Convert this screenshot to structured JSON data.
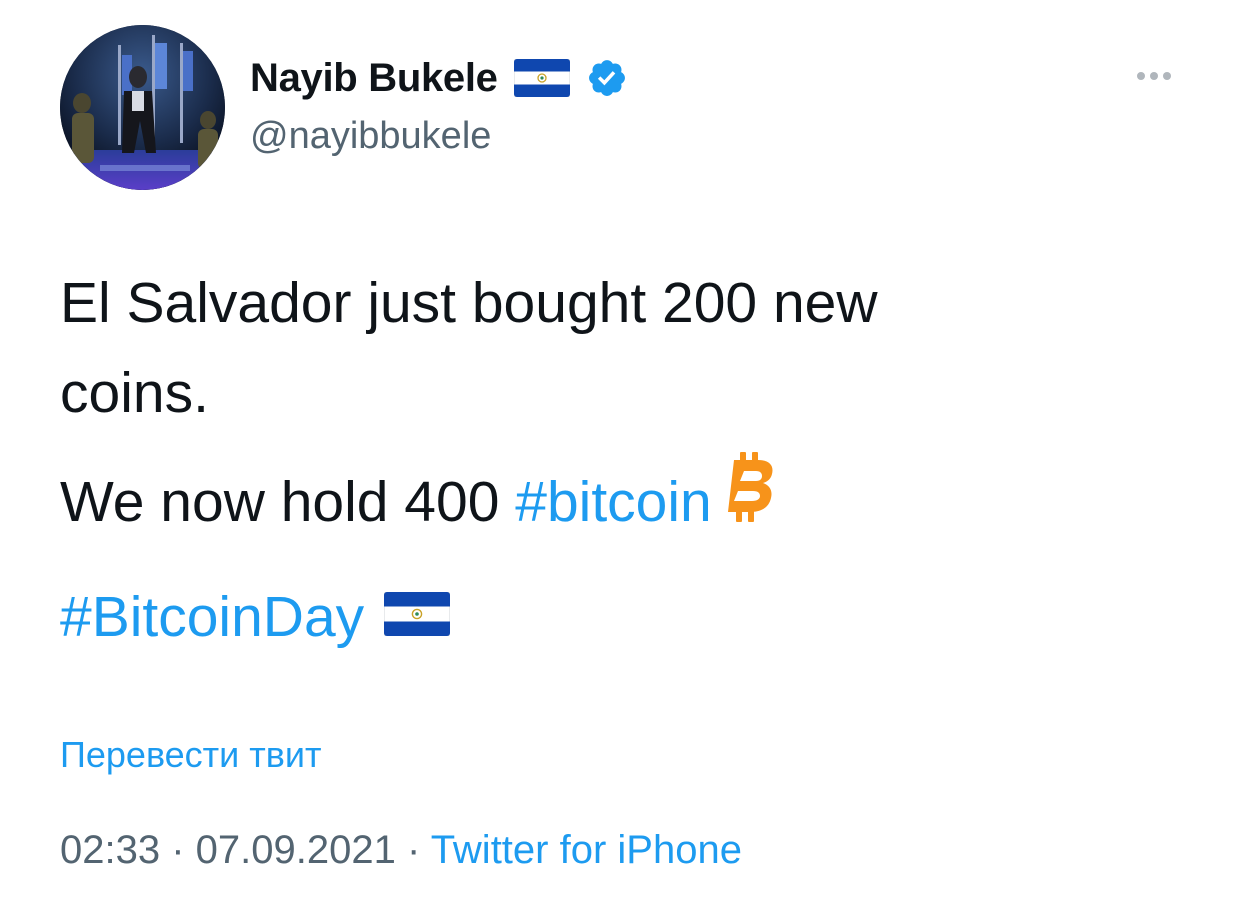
{
  "author": {
    "display_name": "Nayib Bukele",
    "handle": "@nayibbukele",
    "flag_icon": "el-salvador-flag-icon",
    "verified_icon": "verified-badge-icon"
  },
  "tweet": {
    "line1": "El Salvador just bought 200 new",
    "line2": "coins.",
    "line3_text": "We now hold 400 ",
    "hashtag1": "#bitcoin",
    "hashtag2": "#BitcoinDay",
    "emoji_bitcoin": "bitcoin-icon",
    "emoji_flag": "el-salvador-flag-icon"
  },
  "translate_label": "Перевести твит",
  "meta": {
    "time": "02:33",
    "separator1": " · ",
    "date": "07.09.2021",
    "separator2": " · ",
    "source": "Twitter for iPhone"
  },
  "colors": {
    "link": "#1d9bf0",
    "secondary_text": "#536471",
    "primary_text": "#0f1419",
    "bitcoin_orange": "#f7931a",
    "flag_blue": "#0f47af"
  }
}
